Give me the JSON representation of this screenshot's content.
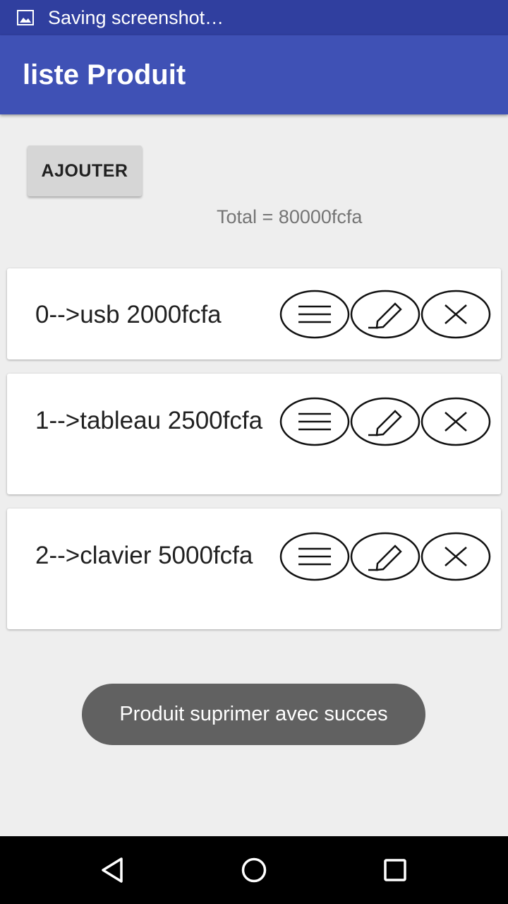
{
  "status_bar": {
    "text": "Saving screenshot…",
    "icon": "image-icon"
  },
  "app_bar": {
    "title": "liste Produit",
    "color": "#3f51b5"
  },
  "add_button": {
    "label": "AJOUTER"
  },
  "total": {
    "text": "Total = 80000fcfa"
  },
  "products": [
    {
      "text": "0-->usb 2000fcfa"
    },
    {
      "text": "1-->tableau 2500fcfa"
    },
    {
      "text": "2-->clavier 5000fcfa"
    }
  ],
  "item_actions": [
    "details-icon",
    "edit-icon",
    "delete-icon"
  ],
  "toast": {
    "text": "Produit suprimer avec succes"
  },
  "nav": [
    "back-icon",
    "home-icon",
    "recents-icon"
  ]
}
